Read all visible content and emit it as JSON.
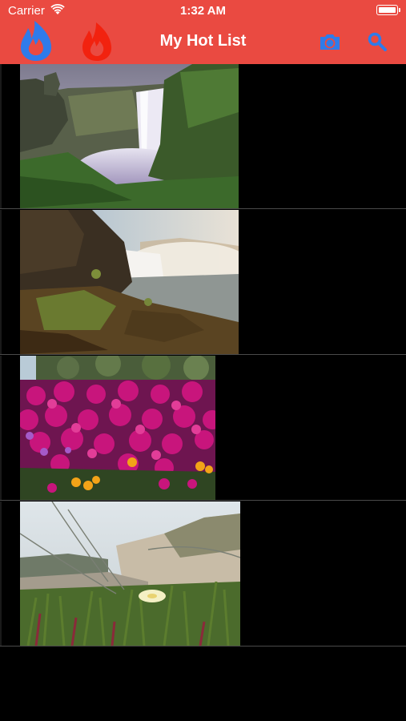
{
  "status_bar": {
    "carrier": "Carrier",
    "time": "1:32 AM"
  },
  "navbar": {
    "title": "My Hot List",
    "left_icons": [
      "flame-blue-icon",
      "flame-red-icon"
    ],
    "right_icons": [
      "camera-switch-icon",
      "search-icon"
    ]
  },
  "colors": {
    "header_bg": "#ea4a41",
    "icon_blue": "#2f7bea",
    "icon_red": "#f2220f",
    "background": "#000000"
  },
  "photos": [
    {
      "subject": "waterfall"
    },
    {
      "subject": "waterfall-coast"
    },
    {
      "subject": "pink-flowers"
    },
    {
      "subject": "dune-grass-flower"
    }
  ]
}
